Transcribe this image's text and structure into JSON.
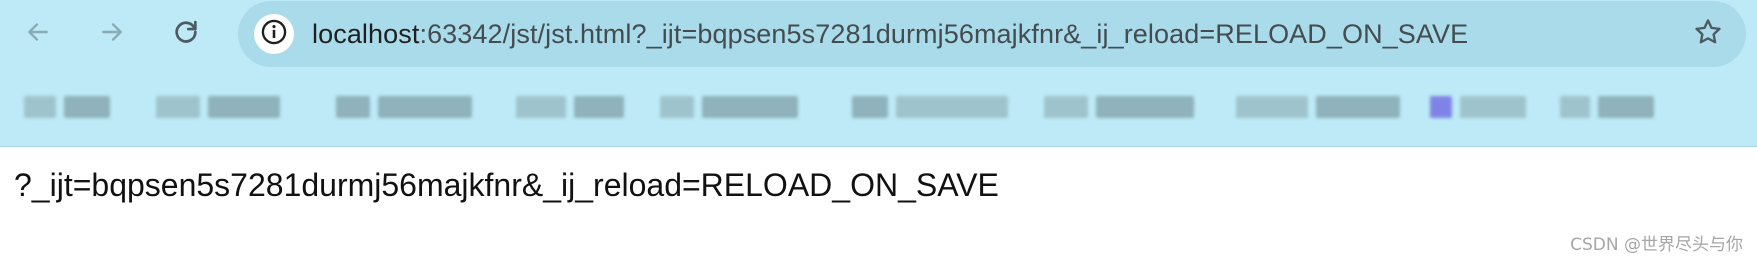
{
  "toolbar": {
    "back_icon": "arrow-left-icon",
    "forward_icon": "arrow-right-icon",
    "reload_icon": "reload-icon",
    "bookmark_star_icon": "star-outline-icon"
  },
  "omnibox": {
    "site_info_icon": "info-icon",
    "url_host": "localhost",
    "url_rest": ":63342/jst/jst.html?_ijt=bqpsen5s7281durmj56majkfnr&_ij_reload=RELOAD_ON_SAVE"
  },
  "bookmarks_bar": {
    "note": "",
    "items_count_visible": 11
  },
  "page": {
    "body_text": "?_ijt=bqpsen5s7281durmj56majkfnr&_ij_reload=RELOAD_ON_SAVE"
  },
  "watermark": {
    "text": "CSDN @世界尽头与你"
  },
  "colors": {
    "chrome_background": "#bdeaf6",
    "omnibox_background": "#a9dbea",
    "icon_color": "#4d5a60",
    "disabled_icon_color": "#8aaab4"
  }
}
